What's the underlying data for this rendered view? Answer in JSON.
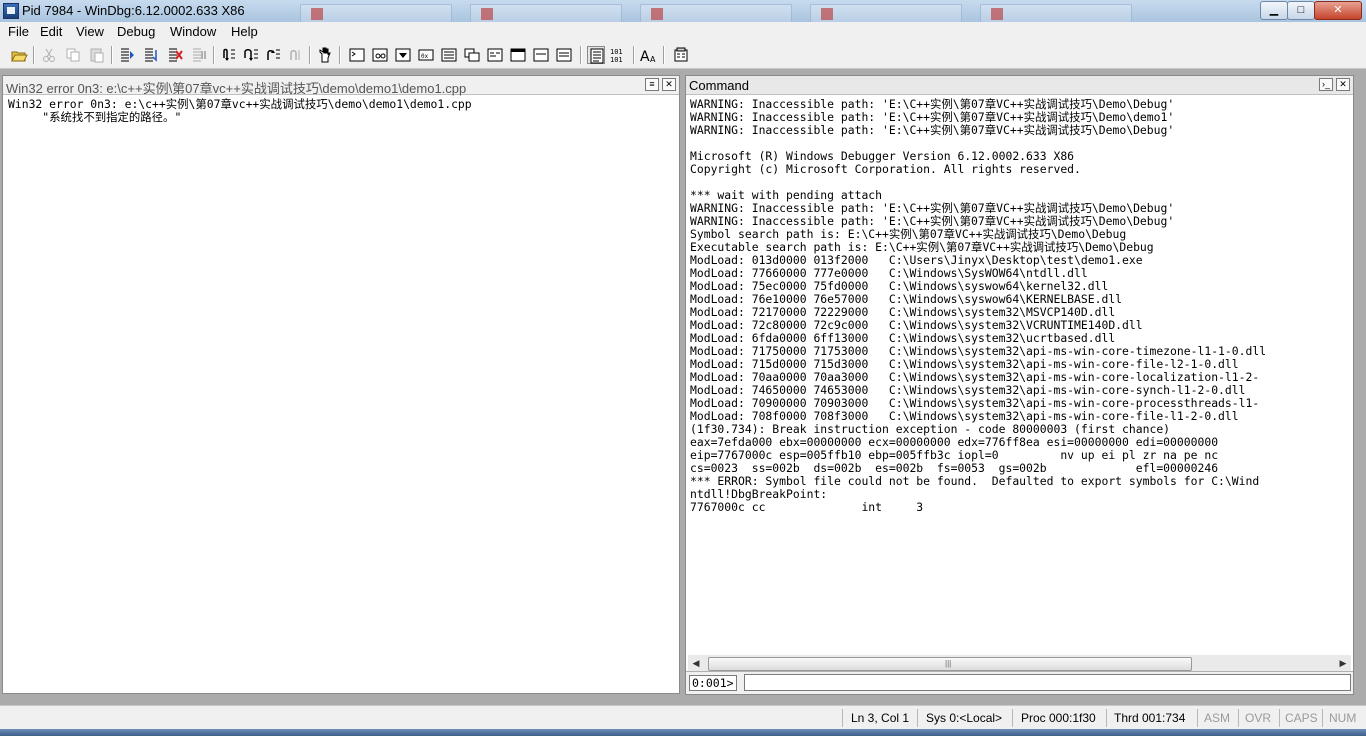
{
  "window": {
    "title": "Pid 7984 - WinDbg:6.12.0002.633 X86",
    "min_glyph": "▁",
    "max_glyph": "□",
    "close_glyph": "✕"
  },
  "menu": [
    "File",
    "Edit",
    "View",
    "Debug",
    "Window",
    "Help"
  ],
  "toolbar": {
    "icons": [
      "open-icon",
      "cut-icon",
      "copy-icon",
      "paste-icon",
      "go-icon",
      "restart-icon",
      "stop-debugging-icon",
      "break-icon",
      "step-into-icon",
      "step-over-icon",
      "step-out-icon",
      "run-to-cursor-icon",
      "breakpoint-icon",
      "command-window-icon",
      "watch-window-icon",
      "locals-window-icon",
      "registers-window-icon",
      "memory-window-icon",
      "call-stack-window-icon",
      "disassembly-window-icon",
      "scratch-pad-icon",
      "source-mode-icon",
      "hex-mode-icon",
      "font-icon",
      "options-icon"
    ],
    "hex_label": "101\n101",
    "font_label": "AA"
  },
  "source_pane": {
    "title": "Win32 error 0n3: e:\\c++实例\\第07章vc++实战调试技巧\\demo\\demo1\\demo1.cpp",
    "lines": [
      "Win32 error 0n3: e:\\c++实例\\第07章vc++实战调试技巧\\demo\\demo1\\demo1.cpp",
      "     \"系统找不到指定的路径。\""
    ]
  },
  "command_pane": {
    "title": "Command",
    "lines": [
      "WARNING: Inaccessible path: 'E:\\C++实例\\第07章VC++实战调试技巧\\Demo\\Debug'",
      "WARNING: Inaccessible path: 'E:\\C++实例\\第07章VC++实战调试技巧\\Demo\\demo1'",
      "WARNING: Inaccessible path: 'E:\\C++实例\\第07章VC++实战调试技巧\\Demo\\Debug'",
      "",
      "Microsoft (R) Windows Debugger Version 6.12.0002.633 X86",
      "Copyright (c) Microsoft Corporation. All rights reserved.",
      "",
      "*** wait with pending attach",
      "WARNING: Inaccessible path: 'E:\\C++实例\\第07章VC++实战调试技巧\\Demo\\Debug'",
      "WARNING: Inaccessible path: 'E:\\C++实例\\第07章VC++实战调试技巧\\Demo\\Debug'",
      "Symbol search path is: E:\\C++实例\\第07章VC++实战调试技巧\\Demo\\Debug",
      "Executable search path is: E:\\C++实例\\第07章VC++实战调试技巧\\Demo\\Debug",
      "ModLoad: 013d0000 013f2000   C:\\Users\\Jinyx\\Desktop\\test\\demo1.exe",
      "ModLoad: 77660000 777e0000   C:\\Windows\\SysWOW64\\ntdll.dll",
      "ModLoad: 75ec0000 75fd0000   C:\\Windows\\syswow64\\kernel32.dll",
      "ModLoad: 76e10000 76e57000   C:\\Windows\\syswow64\\KERNELBASE.dll",
      "ModLoad: 72170000 72229000   C:\\Windows\\system32\\MSVCP140D.dll",
      "ModLoad: 72c80000 72c9c000   C:\\Windows\\system32\\VCRUNTIME140D.dll",
      "ModLoad: 6fda0000 6ff13000   C:\\Windows\\system32\\ucrtbased.dll",
      "ModLoad: 71750000 71753000   C:\\Windows\\system32\\api-ms-win-core-timezone-l1-1-0.dll",
      "ModLoad: 715d0000 715d3000   C:\\Windows\\system32\\api-ms-win-core-file-l2-1-0.dll",
      "ModLoad: 70aa0000 70aa3000   C:\\Windows\\system32\\api-ms-win-core-localization-l1-2-",
      "ModLoad: 74650000 74653000   C:\\Windows\\system32\\api-ms-win-core-synch-l1-2-0.dll",
      "ModLoad: 70900000 70903000   C:\\Windows\\system32\\api-ms-win-core-processthreads-l1-",
      "ModLoad: 708f0000 708f3000   C:\\Windows\\system32\\api-ms-win-core-file-l1-2-0.dll",
      "(1f30.734): Break instruction exception - code 80000003 (first chance)",
      "eax=7efda000 ebx=00000000 ecx=00000000 edx=776ff8ea esi=00000000 edi=00000000",
      "eip=7767000c esp=005ffb10 ebp=005ffb3c iopl=0         nv up ei pl zr na pe nc",
      "cs=0023  ss=002b  ds=002b  es=002b  fs=0053  gs=002b             efl=00000246",
      "*** ERROR: Symbol file could not be found.  Defaulted to export symbols for C:\\Wind",
      "ntdll!DbgBreakPoint:",
      "7767000c cc              int     3"
    ],
    "prompt": "0:001>",
    "input_value": ""
  },
  "status": {
    "position": "Ln 3, Col 1",
    "sys": "Sys 0:<Local>",
    "proc": "Proc 000:1f30",
    "thrd": "Thrd 001:734",
    "asm": "ASM",
    "ovr": "OVR",
    "caps": "CAPS",
    "num": "NUM"
  }
}
